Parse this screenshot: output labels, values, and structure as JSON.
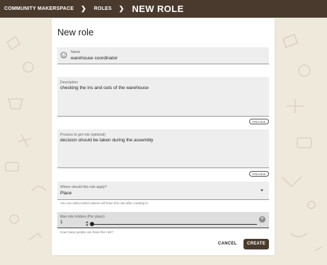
{
  "breadcrumb": {
    "items": [
      "COMMUNITY MAKERSPACE",
      "ROLES"
    ],
    "current": "NEW ROLE"
  },
  "form": {
    "title": "New role",
    "name": {
      "label": "Name",
      "value": "warehouse coordinator",
      "icon": "face-icon"
    },
    "description": {
      "label": "Description",
      "value": "checking the ins and outs of the warehouse",
      "preview_label": "PREVIEW"
    },
    "process": {
      "label": "Process to get role (optional)",
      "value": "decision should be taken during the assembly",
      "preview_label": "PREVIEW"
    },
    "applies_to": {
      "label": "Where should this role apply?",
      "value": "Place",
      "helper": "You can select which places will have this role after creating it!"
    },
    "max_holders": {
      "label": "Max role holders (Per place)",
      "value": "1",
      "helper": "How many people can have this role?"
    }
  },
  "actions": {
    "cancel": "CANCEL",
    "create": "CREATE"
  },
  "colors": {
    "brand": "#4a3a2d",
    "background": "#efe9dc",
    "field": "#eeeeee"
  }
}
